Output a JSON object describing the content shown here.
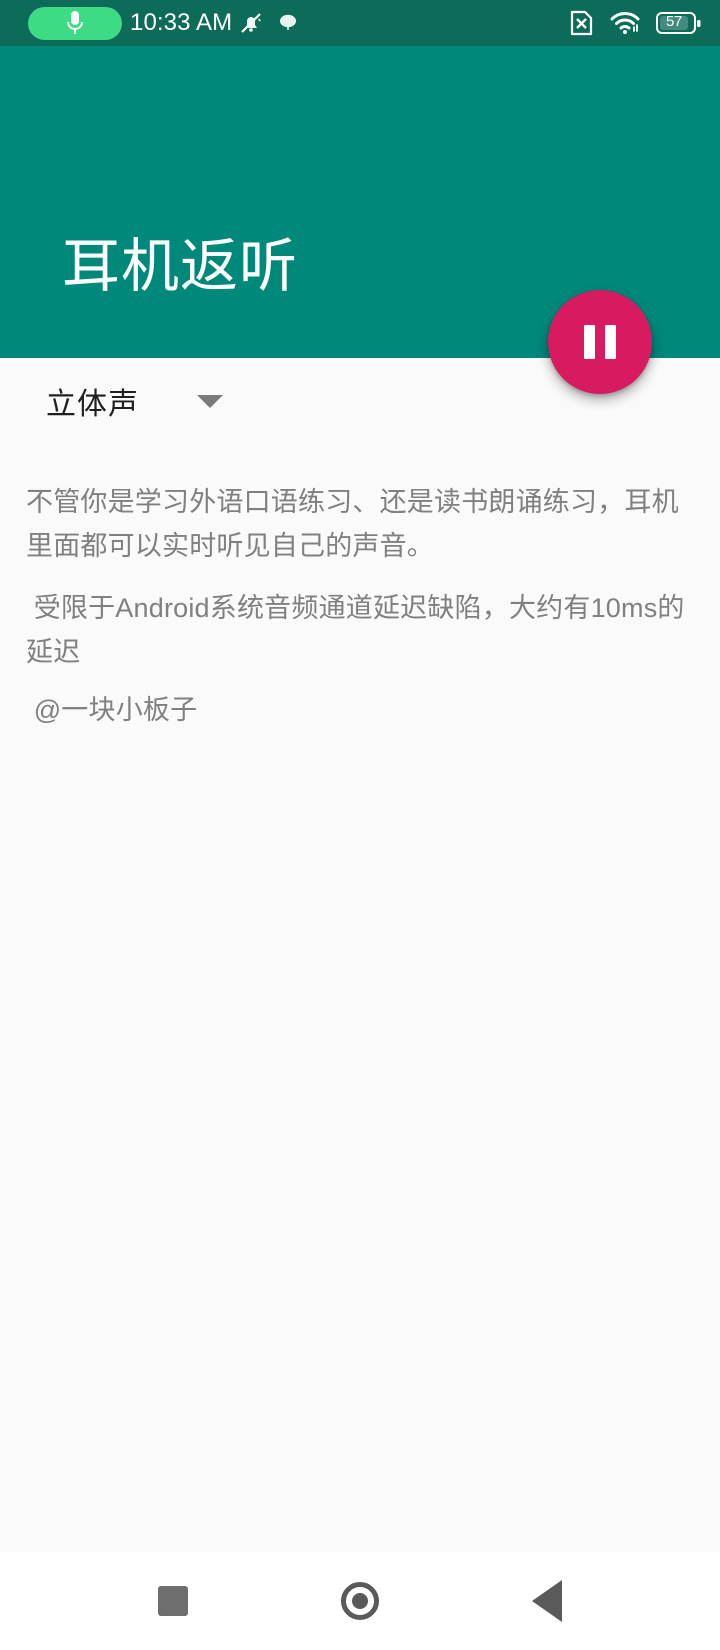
{
  "status_bar": {
    "time": "10:33 AM",
    "battery_percent": "57",
    "mic_indicator_icon": "microphone-icon",
    "notifications_muted_icon": "bell-muted-icon",
    "weather_icon": "cloud-icon",
    "sim_icon": "no-sim-icon",
    "wifi_icon": "wifi-icon",
    "battery_icon": "battery-icon",
    "background_color": "#0d6b5a",
    "mic_pill_color": "#3ddc84"
  },
  "app_bar": {
    "title": "耳机返听",
    "background_color": "#00887a",
    "title_color": "#ffffff"
  },
  "fab": {
    "icon": "pause-icon",
    "color": "#d81b60",
    "icon_color": "#ffffff"
  },
  "mode_select": {
    "selected_value": "立体声",
    "caret_icon": "chevron-down-icon",
    "options": [
      "立体声"
    ]
  },
  "description": {
    "paragraph_1": "不管你是学习外语口语练习、还是读书朗诵练习，耳机里面都可以实时听见自己的声音。",
    "paragraph_2": " 受限于Android系统音频通道延迟缺陷，大约有10ms的延迟",
    "paragraph_3": " @一块小板子",
    "text_color": "#808080"
  },
  "nav_bar": {
    "recent_apps_icon": "square-icon",
    "home_icon": "circle-icon",
    "back_icon": "triangle-left-icon",
    "background_color": "#ffffff"
  }
}
